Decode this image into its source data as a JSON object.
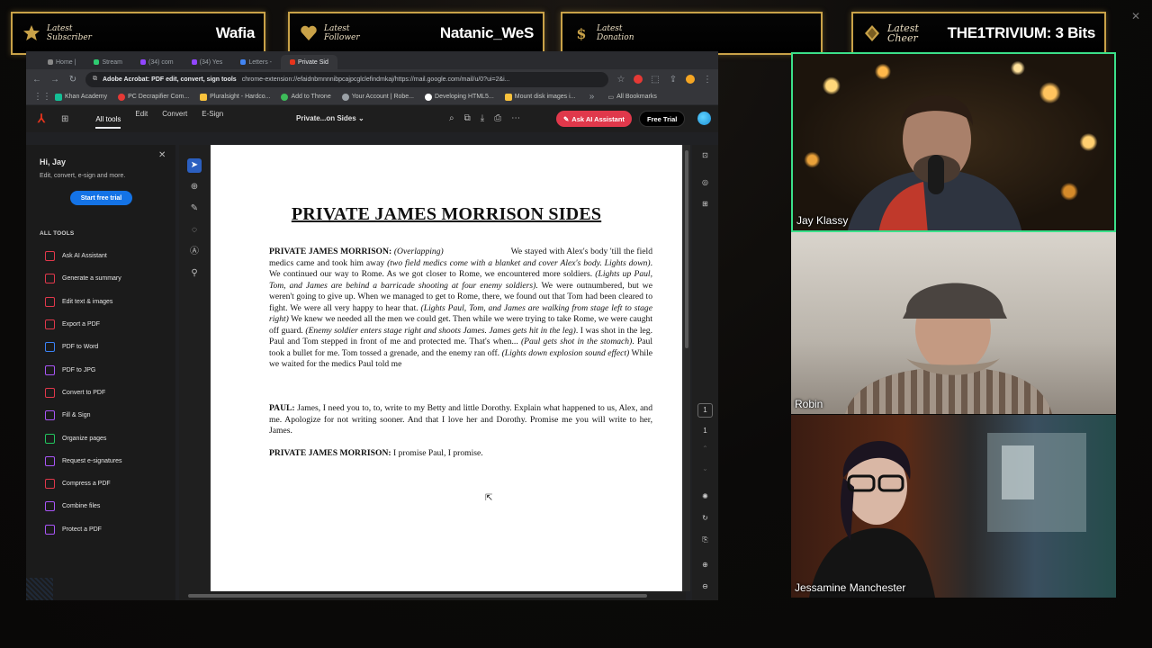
{
  "banners": [
    {
      "label": "Latest Subscriber",
      "value": "Wafia"
    },
    {
      "label": "Latest Follower",
      "value": "Natanic_WeS"
    },
    {
      "label": "Latest Donation",
      "value": ""
    },
    {
      "label": "Latest Cheer",
      "value": "THE1TRIVIUM: 3 Bits"
    }
  ],
  "browser": {
    "tabs": [
      "Home |",
      "Stream",
      "(34) com",
      "(34) Yes",
      "Letters -",
      "Private Sid"
    ],
    "url_title": "Adobe Acrobat: PDF edit, convert, sign tools",
    "url": "chrome-extension://efaidnbmnnnibpcajpcglclefindmkaj/https://mail.google.com/mail/u/0?ui=2&i...",
    "bookmarks": [
      "Khan Academy",
      "PC Decrapifier Com...",
      "Pluralsight - Hardco...",
      "Add to Throne",
      "Your Account | Robe...",
      "Developing HTML5...",
      "Mount disk images i...",
      "All Bookmarks"
    ]
  },
  "acrobat": {
    "menu": [
      "All tools",
      "Edit",
      "Convert",
      "E-Sign"
    ],
    "doc_title": "Private...on Sides",
    "ai_button": "Ask AI Assistant",
    "trial_button": "Free Trial",
    "greeting": "Hi, Jay",
    "subtitle": "Edit, convert, e-sign and more.",
    "start_trial": "Start free trial",
    "all_tools_heading": "ALL TOOLS",
    "tools": [
      {
        "label": "Ask AI Assistant",
        "color": "#e0384b"
      },
      {
        "label": "Generate a summary",
        "color": "#e0384b"
      },
      {
        "label": "Edit text & images",
        "color": "#e0384b"
      },
      {
        "label": "Export a PDF",
        "color": "#e0384b"
      },
      {
        "label": "PDF to Word",
        "color": "#3b82f6"
      },
      {
        "label": "PDF to JPG",
        "color": "#a855f7"
      },
      {
        "label": "Convert to PDF",
        "color": "#e0384b"
      },
      {
        "label": "Fill & Sign",
        "color": "#a855f7"
      },
      {
        "label": "Organize pages",
        "color": "#22c55e"
      },
      {
        "label": "Request e-signatures",
        "color": "#a855f7"
      },
      {
        "label": "Compress a PDF",
        "color": "#e0384b"
      },
      {
        "label": "Combine files",
        "color": "#a855f7"
      },
      {
        "label": "Protect a PDF",
        "color": "#a855f7"
      }
    ],
    "page_number": "1",
    "page_total": "1"
  },
  "document": {
    "title": "PRIVATE JAMES MORRISON SIDES",
    "p1_speaker": "PRIVATE JAMES MORRISON:",
    "p1_html": "<i>(Overlapping)</i>&nbsp;&nbsp;&nbsp;&nbsp;&nbsp;&nbsp;&nbsp;&nbsp;&nbsp;&nbsp;&nbsp;&nbsp;&nbsp;&nbsp;&nbsp;&nbsp;&nbsp;&nbsp;&nbsp;&nbsp;&nbsp;&nbsp;&nbsp;&nbsp;&nbsp;&nbsp;&nbsp; We stayed with Alex's body 'till the field medics came and took him away <i>(two field medics come with a blanket and cover Alex's body. Lights down)</i>. We continued our way to Rome. As we got closer to Rome, we encountered more soldiers. <i>(Lights up Paul, Tom, and James are behind a barricade shooting at four enemy soldiers)</i>. We were outnumbered, but we weren't going to give up. When we managed to get to Rome, there, we found out that Tom had been cleared to fight. We were all very happy to hear that. <i>(Lights Paul, Tom, and James are walking from stage left to stage right)</i> We knew we needed all the men we could get. Then while we were trying to take Rome, we were caught off guard. <i>(Enemy soldier enters stage right and shoots James. James gets hit in the leg)</i>. I was shot in the leg. Paul and Tom stepped in front of me and protected me. That's when... <i>(Paul gets shot in the stomach)</i>. Paul took a bullet for me. Tom tossed a grenade, and the enemy ran off. <i>(Lights down explosion sound effect)</i> While we waited for the medics Paul told me",
    "p2_speaker": "PAUL:",
    "p2_text": "James, I need you to, to, write to my Betty and little Dorothy. Explain what happened to us, Alex, and me. Apologize for not writing sooner. And that I love her and Dorothy. Promise me you will write to her, James.",
    "p3_speaker": "PRIVATE JAMES MORRISON:",
    "p3_text": "I promise Paul, I promise."
  },
  "cams": [
    {
      "name": "Jay Klassy"
    },
    {
      "name": "Robin"
    },
    {
      "name": "Jessamine Manchester"
    }
  ]
}
